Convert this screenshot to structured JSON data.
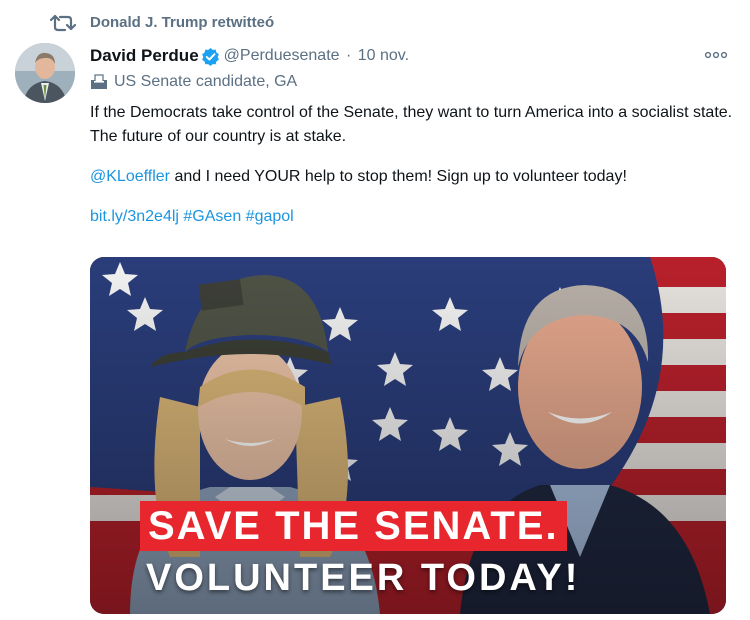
{
  "retweet": {
    "icon": "retweet-icon",
    "text": "Donald J. Trump retwitteó"
  },
  "tweet": {
    "avatar_icon": "avatar",
    "author": {
      "name": "David Perdue",
      "verified_icon": "verified-badge-icon",
      "handle": "@Perduesenate",
      "separator": "·",
      "date": "10 nov."
    },
    "more_icon": "more-options-icon",
    "label": {
      "icon": "ballot-box-icon",
      "text": "US Senate candidate, GA"
    },
    "text": {
      "p1": "If the Democrats take control of the Senate, they want to turn America into a socialist state. The future of our country is at stake.",
      "p2_mention": "@KLoeffler",
      "p2_rest": " and I need YOUR help to stop them! Sign up to volunteer today!",
      "p3_link": "bit.ly/3n2e4lj",
      "p3_hashtag1": "#GAsen",
      "p3_hashtag2": "#gapol"
    },
    "media": {
      "banner_line1": "SAVE THE SENATE.",
      "banner_line2": "VOLUNTEER TODAY!"
    }
  },
  "colors": {
    "link": "#1b95e0",
    "secondary_text": "#5b7083",
    "verified": "#1da1f2",
    "banner_red": "#e8262d"
  }
}
